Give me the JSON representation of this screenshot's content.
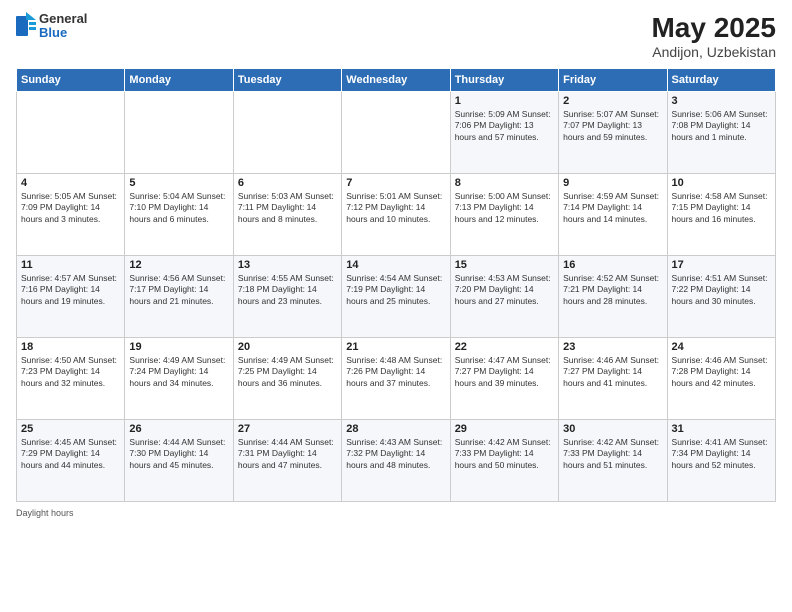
{
  "header": {
    "logo_general": "General",
    "logo_blue": "Blue",
    "main_title": "May 2025",
    "subtitle": "Andijon, Uzbekistan"
  },
  "days_of_week": [
    "Sunday",
    "Monday",
    "Tuesday",
    "Wednesday",
    "Thursday",
    "Friday",
    "Saturday"
  ],
  "weeks": [
    [
      {
        "day": "",
        "info": ""
      },
      {
        "day": "",
        "info": ""
      },
      {
        "day": "",
        "info": ""
      },
      {
        "day": "",
        "info": ""
      },
      {
        "day": "1",
        "info": "Sunrise: 5:09 AM\nSunset: 7:06 PM\nDaylight: 13 hours and 57 minutes."
      },
      {
        "day": "2",
        "info": "Sunrise: 5:07 AM\nSunset: 7:07 PM\nDaylight: 13 hours and 59 minutes."
      },
      {
        "day": "3",
        "info": "Sunrise: 5:06 AM\nSunset: 7:08 PM\nDaylight: 14 hours and 1 minute."
      }
    ],
    [
      {
        "day": "4",
        "info": "Sunrise: 5:05 AM\nSunset: 7:09 PM\nDaylight: 14 hours and 3 minutes."
      },
      {
        "day": "5",
        "info": "Sunrise: 5:04 AM\nSunset: 7:10 PM\nDaylight: 14 hours and 6 minutes."
      },
      {
        "day": "6",
        "info": "Sunrise: 5:03 AM\nSunset: 7:11 PM\nDaylight: 14 hours and 8 minutes."
      },
      {
        "day": "7",
        "info": "Sunrise: 5:01 AM\nSunset: 7:12 PM\nDaylight: 14 hours and 10 minutes."
      },
      {
        "day": "8",
        "info": "Sunrise: 5:00 AM\nSunset: 7:13 PM\nDaylight: 14 hours and 12 minutes."
      },
      {
        "day": "9",
        "info": "Sunrise: 4:59 AM\nSunset: 7:14 PM\nDaylight: 14 hours and 14 minutes."
      },
      {
        "day": "10",
        "info": "Sunrise: 4:58 AM\nSunset: 7:15 PM\nDaylight: 14 hours and 16 minutes."
      }
    ],
    [
      {
        "day": "11",
        "info": "Sunrise: 4:57 AM\nSunset: 7:16 PM\nDaylight: 14 hours and 19 minutes."
      },
      {
        "day": "12",
        "info": "Sunrise: 4:56 AM\nSunset: 7:17 PM\nDaylight: 14 hours and 21 minutes."
      },
      {
        "day": "13",
        "info": "Sunrise: 4:55 AM\nSunset: 7:18 PM\nDaylight: 14 hours and 23 minutes."
      },
      {
        "day": "14",
        "info": "Sunrise: 4:54 AM\nSunset: 7:19 PM\nDaylight: 14 hours and 25 minutes."
      },
      {
        "day": "15",
        "info": "Sunrise: 4:53 AM\nSunset: 7:20 PM\nDaylight: 14 hours and 27 minutes."
      },
      {
        "day": "16",
        "info": "Sunrise: 4:52 AM\nSunset: 7:21 PM\nDaylight: 14 hours and 28 minutes."
      },
      {
        "day": "17",
        "info": "Sunrise: 4:51 AM\nSunset: 7:22 PM\nDaylight: 14 hours and 30 minutes."
      }
    ],
    [
      {
        "day": "18",
        "info": "Sunrise: 4:50 AM\nSunset: 7:23 PM\nDaylight: 14 hours and 32 minutes."
      },
      {
        "day": "19",
        "info": "Sunrise: 4:49 AM\nSunset: 7:24 PM\nDaylight: 14 hours and 34 minutes."
      },
      {
        "day": "20",
        "info": "Sunrise: 4:49 AM\nSunset: 7:25 PM\nDaylight: 14 hours and 36 minutes."
      },
      {
        "day": "21",
        "info": "Sunrise: 4:48 AM\nSunset: 7:26 PM\nDaylight: 14 hours and 37 minutes."
      },
      {
        "day": "22",
        "info": "Sunrise: 4:47 AM\nSunset: 7:27 PM\nDaylight: 14 hours and 39 minutes."
      },
      {
        "day": "23",
        "info": "Sunrise: 4:46 AM\nSunset: 7:27 PM\nDaylight: 14 hours and 41 minutes."
      },
      {
        "day": "24",
        "info": "Sunrise: 4:46 AM\nSunset: 7:28 PM\nDaylight: 14 hours and 42 minutes."
      }
    ],
    [
      {
        "day": "25",
        "info": "Sunrise: 4:45 AM\nSunset: 7:29 PM\nDaylight: 14 hours and 44 minutes."
      },
      {
        "day": "26",
        "info": "Sunrise: 4:44 AM\nSunset: 7:30 PM\nDaylight: 14 hours and 45 minutes."
      },
      {
        "day": "27",
        "info": "Sunrise: 4:44 AM\nSunset: 7:31 PM\nDaylight: 14 hours and 47 minutes."
      },
      {
        "day": "28",
        "info": "Sunrise: 4:43 AM\nSunset: 7:32 PM\nDaylight: 14 hours and 48 minutes."
      },
      {
        "day": "29",
        "info": "Sunrise: 4:42 AM\nSunset: 7:33 PM\nDaylight: 14 hours and 50 minutes."
      },
      {
        "day": "30",
        "info": "Sunrise: 4:42 AM\nSunset: 7:33 PM\nDaylight: 14 hours and 51 minutes."
      },
      {
        "day": "31",
        "info": "Sunrise: 4:41 AM\nSunset: 7:34 PM\nDaylight: 14 hours and 52 minutes."
      }
    ]
  ],
  "footer": {
    "daylight_hours": "Daylight hours"
  }
}
